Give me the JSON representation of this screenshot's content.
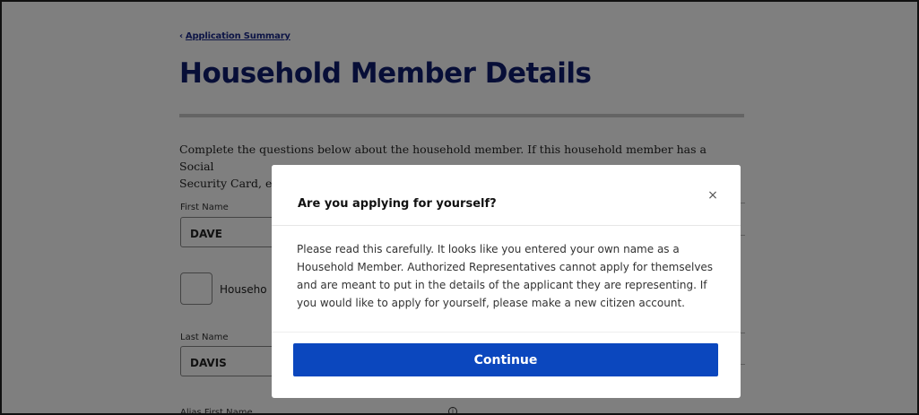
{
  "header": {
    "back_link": "Application Summary",
    "title": "Household Member Details"
  },
  "form": {
    "intro_line1": "Complete the questions below about the household member. If this household member has a Social",
    "intro_line2": "Security Card, er",
    "first_name_label": "First Name",
    "first_name_value": "DAVE",
    "checkbox_label": "Househo",
    "last_name_label": "Last Name",
    "last_name_value": "DAVIS",
    "alias_first_name_label": "Alias First Name"
  },
  "modal": {
    "title": "Are you applying for yourself?",
    "body": "Please read this carefully. It looks like you entered your own name as a Household Member. Authorized Representatives cannot apply for themselves and are meant to put in the details of the applicant they are representing. If you would like to apply for yourself, please make a new citizen account.",
    "continue_label": "Continue",
    "close_glyph": "×"
  },
  "icons": {
    "back": "chevron-left-icon",
    "close": "close-icon",
    "info": "info-icon"
  },
  "colors": {
    "heading": "#0f1d6e",
    "primary_button": "#0b47be",
    "overlay": "rgba(0,0,0,0.5)"
  }
}
